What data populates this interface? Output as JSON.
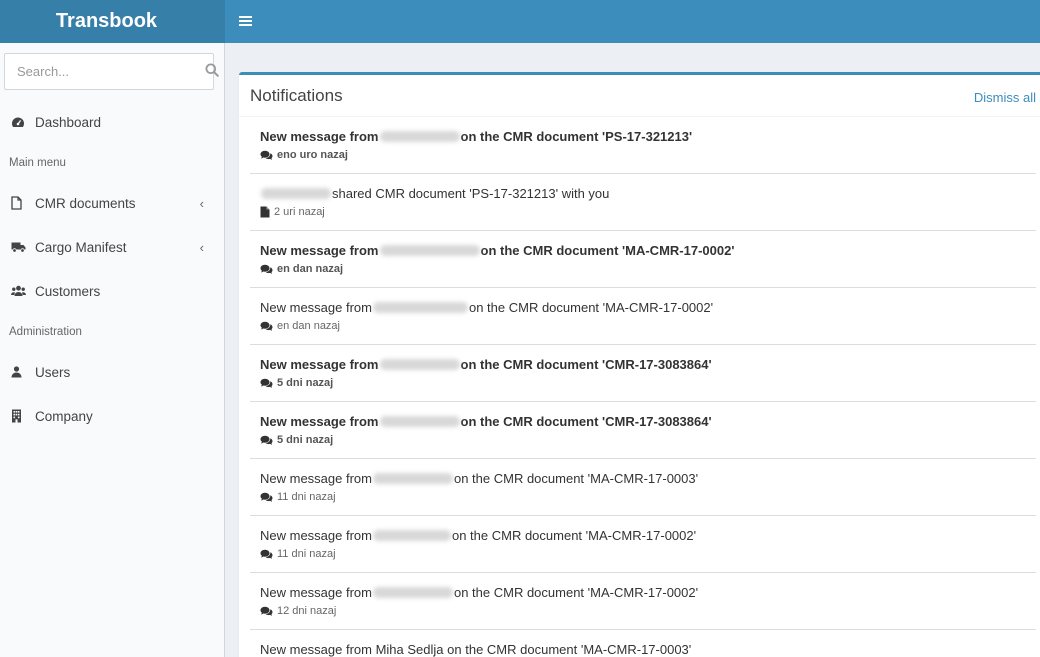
{
  "app": {
    "title": "Transbook"
  },
  "header": {
    "toggle_icon": "hamburger-menu-icon"
  },
  "sidebar": {
    "search_placeholder": "Search...",
    "items": [
      {
        "type": "item",
        "label": "Dashboard",
        "icon": "dashboard-icon"
      },
      {
        "type": "header",
        "label": "Main menu"
      },
      {
        "type": "item",
        "label": "CMR documents",
        "icon": "file-icon",
        "chevron": "‹"
      },
      {
        "type": "item",
        "label": "Cargo Manifest",
        "icon": "truck-icon",
        "chevron": "‹"
      },
      {
        "type": "item",
        "label": "Customers",
        "icon": "users-icon"
      },
      {
        "type": "header",
        "label": "Administration"
      },
      {
        "type": "item",
        "label": "Users",
        "icon": "user-icon"
      },
      {
        "type": "item",
        "label": "Company",
        "icon": "building-icon"
      }
    ]
  },
  "notifications": {
    "title": "Notifications",
    "dismiss_all": "Dismiss all",
    "items": [
      {
        "pre": "New message from",
        "post": "on the CMR document 'PS-17-321213'",
        "time": "eno uro nazaj",
        "unread": true,
        "icon": "comments-icon"
      },
      {
        "pre": "",
        "post": "shared CMR document 'PS-17-321213' with you",
        "time": "2 uri nazaj",
        "unread": false,
        "icon": "document-icon"
      },
      {
        "pre": "New message from",
        "post": "on the CMR document 'MA-CMR-17-0002'",
        "time": "en dan nazaj",
        "unread": true,
        "icon": "comments-icon"
      },
      {
        "pre": "New message from",
        "post": "on the CMR document 'MA-CMR-17-0002'",
        "time": "en dan nazaj",
        "unread": false,
        "icon": "comments-icon"
      },
      {
        "pre": "New message from",
        "post": "on the CMR document 'CMR-17-3083864'",
        "time": "5 dni nazaj",
        "unread": true,
        "icon": "comments-icon"
      },
      {
        "pre": "New message from",
        "post": "on the CMR document 'CMR-17-3083864'",
        "time": "5 dni nazaj",
        "unread": true,
        "icon": "comments-icon"
      },
      {
        "pre": "New message from",
        "post": "on the CMR document 'MA-CMR-17-0003'",
        "time": "11 dni nazaj",
        "unread": false,
        "icon": "comments-icon"
      },
      {
        "pre": "New message from",
        "post": "on the CMR document 'MA-CMR-17-0002'",
        "time": "11 dni nazaj",
        "unread": false,
        "icon": "comments-icon"
      },
      {
        "pre": "New message from",
        "post": "on the CMR document 'MA-CMR-17-0002'",
        "time": "12 dni nazaj",
        "unread": false,
        "icon": "comments-icon"
      },
      {
        "pre": "New message from Miha Sedlja",
        "post": "on the CMR document 'MA-CMR-17-0003'",
        "time": "",
        "unread": false,
        "icon": "comments-icon"
      }
    ]
  }
}
